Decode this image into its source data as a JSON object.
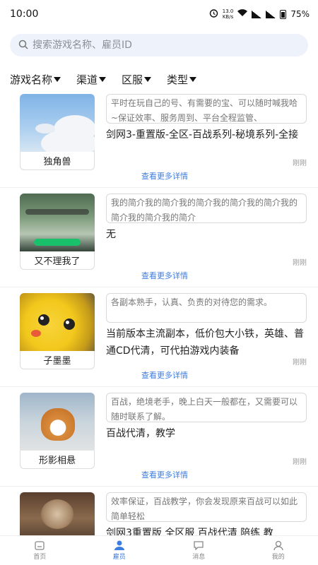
{
  "status_bar": {
    "time": "10:00",
    "speed_value": "13.0",
    "speed_unit": "KB/s",
    "battery": "75%"
  },
  "search": {
    "placeholder": "搜索游戏名称、雇员ID",
    "icon": "search-icon"
  },
  "filters": [
    {
      "label": "游戏名称"
    },
    {
      "label": "渠道"
    },
    {
      "label": "区服"
    },
    {
      "label": "类型"
    }
  ],
  "cards": [
    {
      "name": "独角兽",
      "intro": "平时在玩自己的号、有需要的宝、可以随时喊我哈~保证效率、服务周到、平台全程监管、",
      "services": "剑网3-重置版-全区-百战系列-秘境系列-全接",
      "more": "查看更多详情",
      "time": "刚刚"
    },
    {
      "name": "又不理我了",
      "intro": "我的简介我的简介我的简介我的简介我的简介我的简介我的简介我的简介",
      "services": "无",
      "more": "查看更多详情",
      "time": "刚刚"
    },
    {
      "name": "子墨墨",
      "intro": "各副本熟手，认真、负责的对待您的需求。",
      "services": "当前版本主流副本，低价包大小铁，英雄、普通CD代清，可代拍游戏内装备",
      "more": "查看更多详情",
      "time": "刚刚"
    },
    {
      "name": "形影相悬",
      "intro": "百战，绝境老手，晚上白天一般都在，又需要可以随时联系了解。",
      "services": "百战代清，教学",
      "more": "查看更多详情",
      "time": "刚刚"
    },
    {
      "name": "",
      "intro": "效率保证，百战教学，你会发现原来百战可以如此简单轻松",
      "services": "剑网3重置版 全区服 百战代清 陪练 教",
      "more": "",
      "time": ""
    }
  ],
  "tabbar": [
    {
      "label": "首页",
      "icon": "home-icon",
      "active": false
    },
    {
      "label": "雇员",
      "icon": "person-icon",
      "active": true
    },
    {
      "label": "消息",
      "icon": "message-icon",
      "active": false
    },
    {
      "label": "我的",
      "icon": "profile-icon",
      "active": false
    }
  ],
  "colors": {
    "accent": "#3d7de0",
    "search_bg": "#eef2fa"
  }
}
